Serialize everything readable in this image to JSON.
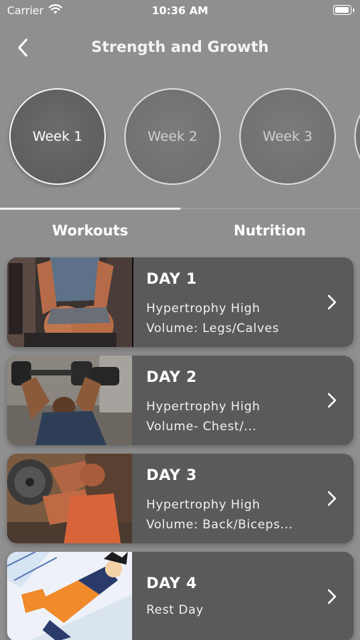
{
  "status_bar": {
    "carrier": "Carrier",
    "time": "10:36 AM"
  },
  "nav": {
    "title": "Strength and Growth",
    "back_icon": "chevron-left-icon"
  },
  "weeks": [
    {
      "label": "Week 1",
      "active": true
    },
    {
      "label": "Week 2",
      "active": false
    },
    {
      "label": "Week 3",
      "active": false
    }
  ],
  "tabs": [
    {
      "label": "Workouts",
      "selected": true
    },
    {
      "label": "Nutrition",
      "selected": false
    }
  ],
  "days": [
    {
      "day": "DAY 1",
      "line1": "Hypertrophy High",
      "line2": "Volume: Legs/Calves",
      "image": "leg-workout-photo"
    },
    {
      "day": "DAY 2",
      "line1": "Hypertrophy High",
      "line2": "Volume- Chest/...",
      "image": "bench-press-photo"
    },
    {
      "day": "DAY 3",
      "line1": "Hypertrophy High",
      "line2": "Volume: Back/Biceps...",
      "image": "bicep-curl-photo"
    },
    {
      "day": "DAY 4",
      "line1": "Rest Day",
      "line2": "",
      "image": "anime-character-image"
    }
  ],
  "colors": {
    "background": "#8f8f8f",
    "card": "#5a5a5a",
    "active_circle": "#5f5f5f",
    "inactive_circle": "#707070"
  }
}
